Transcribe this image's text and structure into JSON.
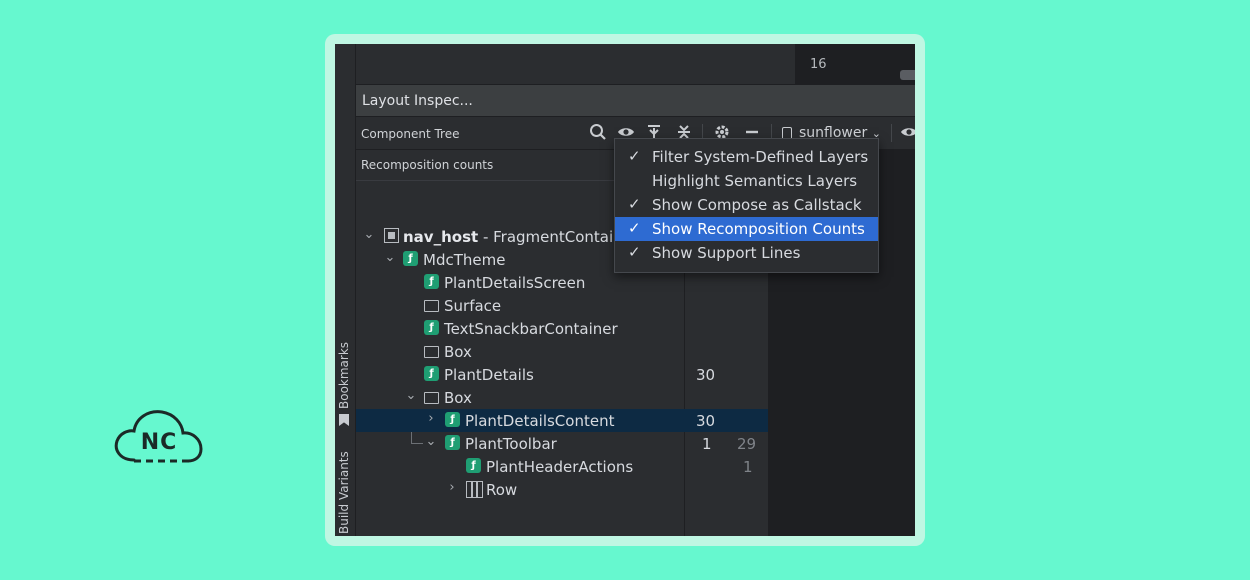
{
  "logo": {
    "text": "NC"
  },
  "editor": {
    "line_number": "16"
  },
  "sidebar": {
    "bookmarks_label": "Bookmarks",
    "build_variants_label": "Build Variants"
  },
  "panel": {
    "title": "Layout Inspec..."
  },
  "toolbar": {
    "component_tree_label": "Component Tree",
    "device_label": "sunflower",
    "icons": [
      "search-icon",
      "eye-icon",
      "filter-icon",
      "collapse-icon",
      "gear-icon",
      "minimize-icon",
      "phone-icon",
      "eye-icon"
    ]
  },
  "tree": {
    "header": "Recomposition counts",
    "rows": [
      {
        "name": "nav_host",
        "suffix": " - FragmentContaine",
        "count": "",
        "skips": ""
      },
      {
        "name": "MdcTheme",
        "suffix": "",
        "count": "",
        "skips": ""
      },
      {
        "name": "PlantDetailsScreen",
        "suffix": "",
        "count": "",
        "skips": ""
      },
      {
        "name": "Surface",
        "suffix": "",
        "count": "",
        "skips": ""
      },
      {
        "name": "TextSnackbarContainer",
        "suffix": "",
        "count": "",
        "skips": ""
      },
      {
        "name": "Box",
        "suffix": "",
        "count": "",
        "skips": ""
      },
      {
        "name": "PlantDetails",
        "suffix": "",
        "count": "30",
        "skips": ""
      },
      {
        "name": "Box",
        "suffix": "",
        "count": "",
        "skips": ""
      },
      {
        "name": "PlantDetailsContent",
        "suffix": "",
        "count": "30",
        "skips": ""
      },
      {
        "name": "PlantToolbar",
        "suffix": "",
        "count": "1",
        "skips": "29"
      },
      {
        "name": "PlantHeaderActions",
        "suffix": "",
        "count": "",
        "skips": "1"
      },
      {
        "name": "Row",
        "suffix": "",
        "count": "",
        "skips": ""
      }
    ]
  },
  "menu": {
    "items": [
      {
        "label": "Filter System-Defined Layers",
        "check": "✓"
      },
      {
        "label": "Highlight Semantics Layers",
        "check": ""
      },
      {
        "label": "Show Compose as Callstack",
        "check": "✓"
      },
      {
        "label": "Show Recomposition Counts",
        "check": "✓"
      },
      {
        "label": "Show Support Lines",
        "check": "✓"
      }
    ]
  },
  "colors": {
    "background": "#66f8cf",
    "selection": "#2e6bd2",
    "compose_icon": "#1f9e73"
  }
}
